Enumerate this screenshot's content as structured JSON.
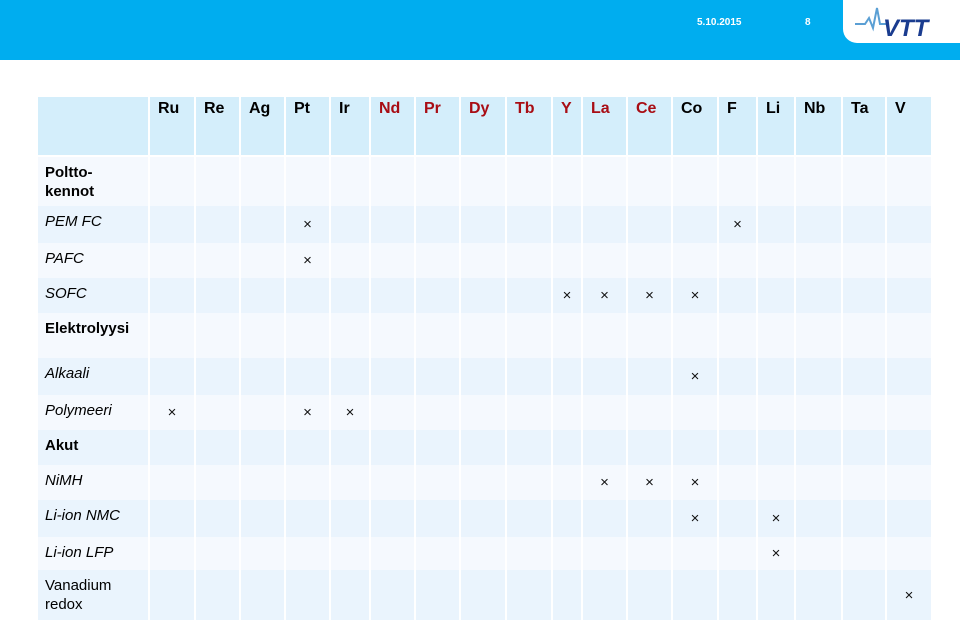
{
  "header": {
    "date": "5.10.2015",
    "page_number": "8",
    "logo_text": "VTT",
    "bar_color": "#00adef"
  },
  "colors": {
    "critical_element": "#a80d14",
    "normal_element": "#000000",
    "header_bg": "#d4eefb",
    "row_light": "#f5f9fe",
    "row_dark": "#eaf4fd"
  },
  "mark_symbol": "×",
  "columns": [
    {
      "symbol": "Ru",
      "critical": false
    },
    {
      "symbol": "Re",
      "critical": false
    },
    {
      "symbol": "Ag",
      "critical": false
    },
    {
      "symbol": "Pt",
      "critical": false
    },
    {
      "symbol": "Ir",
      "critical": false
    },
    {
      "symbol": "Nd",
      "critical": true
    },
    {
      "symbol": "Pr",
      "critical": true
    },
    {
      "symbol": "Dy",
      "critical": true
    },
    {
      "symbol": "Tb",
      "critical": true
    },
    {
      "symbol": "Y",
      "critical": true
    },
    {
      "symbol": "La",
      "critical": true
    },
    {
      "symbol": "Ce",
      "critical": true
    },
    {
      "symbol": "Co",
      "critical": false
    },
    {
      "symbol": "F",
      "critical": false
    },
    {
      "symbol": "Li",
      "critical": false
    },
    {
      "symbol": "Nb",
      "critical": false
    },
    {
      "symbol": "Ta",
      "critical": false
    },
    {
      "symbol": "V",
      "critical": false
    }
  ],
  "rows": [
    {
      "label": "Poltto-\nkennot",
      "style": "group",
      "marks": []
    },
    {
      "label": "PEM FC",
      "style": "sub",
      "marks": [
        "Pt",
        "F"
      ]
    },
    {
      "label": "PAFC",
      "style": "sub",
      "marks": [
        "Pt"
      ]
    },
    {
      "label": "SOFC",
      "style": "sub",
      "marks": [
        "Y",
        "La",
        "Ce",
        "Co"
      ]
    },
    {
      "label": "Elektrolyysi",
      "style": "group",
      "marks": []
    },
    {
      "label": "Alkaali",
      "style": "sub",
      "marks": [
        "Co"
      ]
    },
    {
      "label": "Polymeeri",
      "style": "sub",
      "marks": [
        "Ru",
        "Pt",
        "Ir"
      ]
    },
    {
      "label": "Akut",
      "style": "group",
      "marks": []
    },
    {
      "label": "NiMH",
      "style": "sub",
      "marks": [
        "La",
        "Ce",
        "Co"
      ]
    },
    {
      "label": "Li-ion NMC",
      "style": "sub",
      "marks": [
        "Co",
        "Li"
      ]
    },
    {
      "label": "Li-ion LFP",
      "style": "sub",
      "marks": [
        "Li"
      ]
    },
    {
      "label": "Vanadium\nredox",
      "style": "plain",
      "marks": [
        "V"
      ]
    }
  ]
}
